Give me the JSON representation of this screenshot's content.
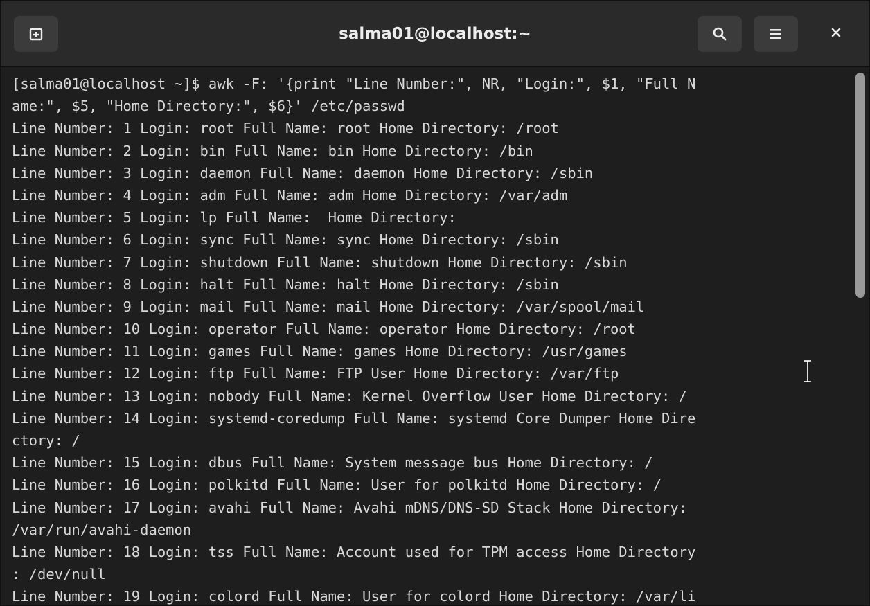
{
  "window": {
    "title": "salma01@localhost:~"
  },
  "icons": {
    "new_tab": "new-tab-icon",
    "search": "search-icon",
    "menu": "hamburger-menu-icon",
    "close": "close-icon",
    "cursor": "text-cursor-icon"
  },
  "colors": {
    "titlebar_bg": "#2a2a2a",
    "button_bg": "#3b3b3b",
    "terminal_bg": "#1e1e1e",
    "terminal_text": "#d8d8d8",
    "scrollbar": "#9a9a9a"
  },
  "terminal": {
    "lines": [
      "[salma01@localhost ~]$ awk -F: '{print \"Line Number:\", NR, \"Login:\", $1, \"Full N",
      "ame:\", $5, \"Home Directory:\", $6}' /etc/passwd",
      "Line Number: 1 Login: root Full Name: root Home Directory: /root",
      "Line Number: 2 Login: bin Full Name: bin Home Directory: /bin",
      "Line Number: 3 Login: daemon Full Name: daemon Home Directory: /sbin",
      "Line Number: 4 Login: adm Full Name: adm Home Directory: /var/adm",
      "Line Number: 5 Login: lp Full Name:  Home Directory:",
      "Line Number: 6 Login: sync Full Name: sync Home Directory: /sbin",
      "Line Number: 7 Login: shutdown Full Name: shutdown Home Directory: /sbin",
      "Line Number: 8 Login: halt Full Name: halt Home Directory: /sbin",
      "Line Number: 9 Login: mail Full Name: mail Home Directory: /var/spool/mail",
      "Line Number: 10 Login: operator Full Name: operator Home Directory: /root",
      "Line Number: 11 Login: games Full Name: games Home Directory: /usr/games",
      "Line Number: 12 Login: ftp Full Name: FTP User Home Directory: /var/ftp",
      "Line Number: 13 Login: nobody Full Name: Kernel Overflow User Home Directory: /",
      "Line Number: 14 Login: systemd-coredump Full Name: systemd Core Dumper Home Dire",
      "ctory: /",
      "Line Number: 15 Login: dbus Full Name: System message bus Home Directory: /",
      "Line Number: 16 Login: polkitd Full Name: User for polkitd Home Directory: /",
      "Line Number: 17 Login: avahi Full Name: Avahi mDNS/DNS-SD Stack Home Directory:",
      "/var/run/avahi-daemon",
      "Line Number: 18 Login: tss Full Name: Account used for TPM access Home Directory",
      ": /dev/null",
      "Line Number: 19 Login: colord Full Name: User for colord Home Directory: /var/li"
    ]
  }
}
